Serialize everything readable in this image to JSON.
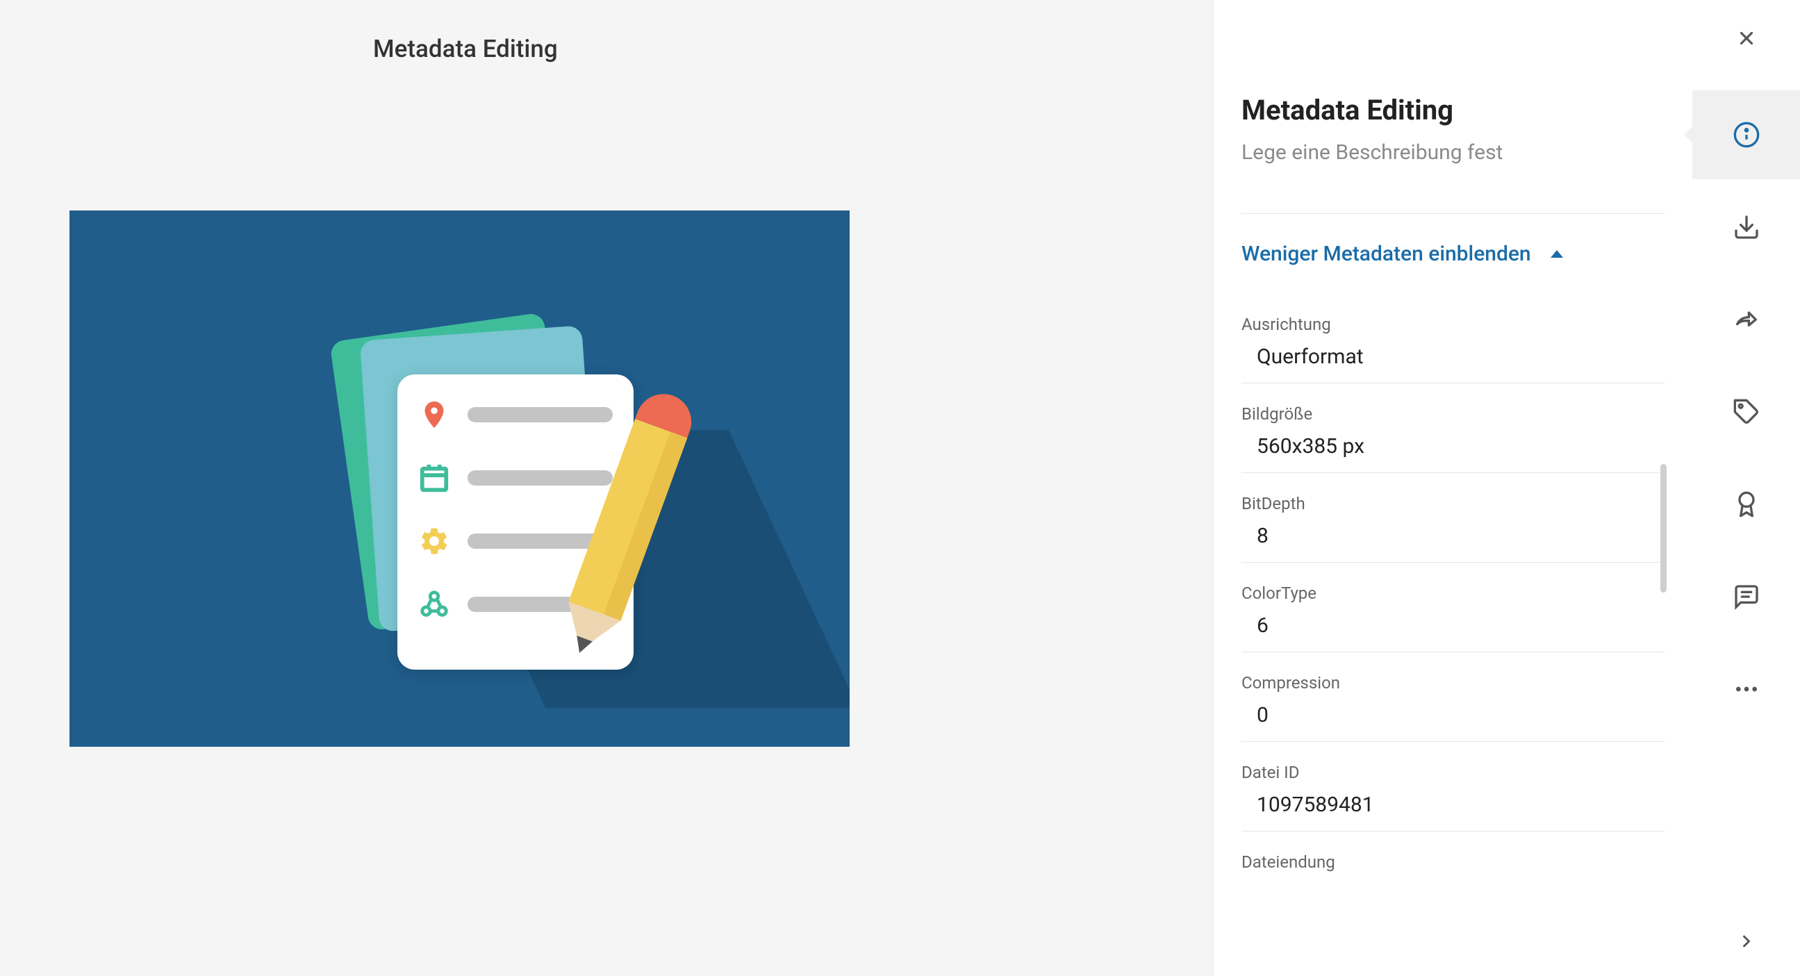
{
  "page_title": "Metadata Editing",
  "detail": {
    "title": "Metadata Editing",
    "description": "Lege eine Beschreibung fest",
    "toggle_label": "Weniger Metadaten einblenden"
  },
  "metadata": [
    {
      "label": "Ausrichtung",
      "value": "Querformat"
    },
    {
      "label": "Bildgröße",
      "value": "560x385 px"
    },
    {
      "label": "BitDepth",
      "value": "8"
    },
    {
      "label": "ColorType",
      "value": "6"
    },
    {
      "label": "Compression",
      "value": "0"
    },
    {
      "label": "Datei ID",
      "value": "1097589481"
    },
    {
      "label": "Dateiendung",
      "value": ""
    }
  ]
}
